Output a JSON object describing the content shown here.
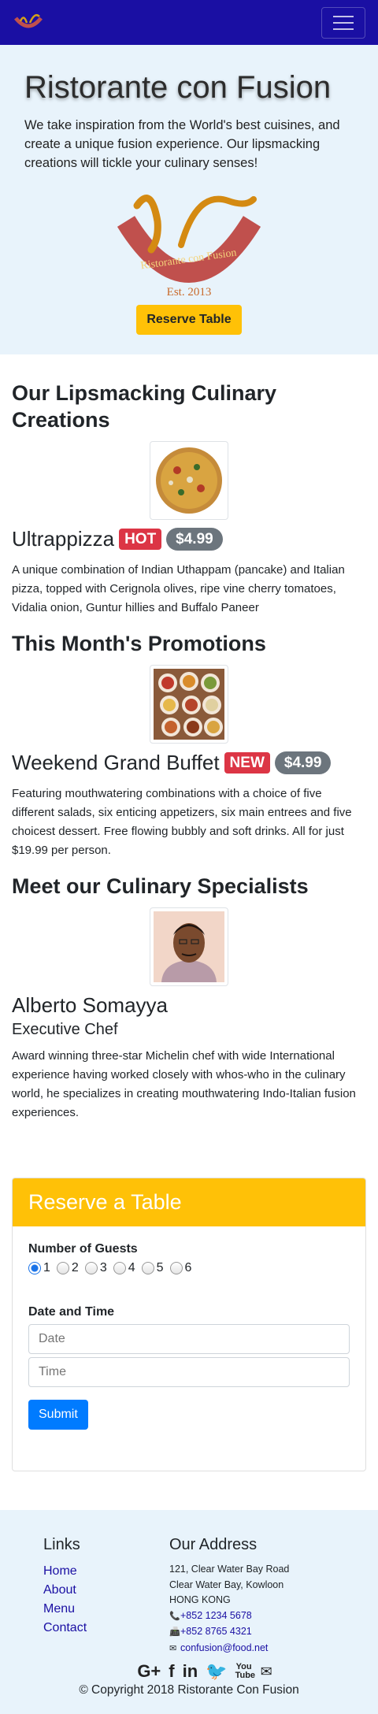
{
  "nav": {
    "logo_icon": "restaurant-logo-icon",
    "toggler_icon": "hamburger-menu-icon"
  },
  "jumbotron": {
    "title": "Ristorante con Fusion",
    "text": "We take inspiration from the World's best cuisines, and create a unique fusion experience. Our lipsmacking creations will tickle your culinary senses!",
    "logo_text": "Ristorante con Fusion",
    "est": "Est. 2013",
    "reserve_label": "Reserve Table"
  },
  "dish": {
    "section": "Our Lipsmacking Culinary Creations",
    "name": "Ultrappizza",
    "badge": "HOT",
    "price": "$4.99",
    "description": "A unique combination of Indian Uthappam (pancake) and Italian pizza, topped with Cerignola olives, ripe vine cherry tomatoes, Vidalia onion, Guntur hillies and Buffalo Paneer"
  },
  "promo": {
    "section": "This Month's Promotions",
    "name": "Weekend Grand Buffet",
    "badge": "NEW",
    "price": "$4.99",
    "description": "Featuring mouthwatering combinations with a choice of five different salads, six enticing appetizers, six main entrees and five choicest dessert. Free flowing bubbly and soft drinks. All for just $19.99 per person."
  },
  "leader": {
    "section": "Meet our Culinary Specialists",
    "name": "Alberto Somayya",
    "title": "Executive Chef",
    "description": "Award winning three-star Michelin chef with wide International experience having worked closely with whos-who in the culinary world, he specializes in creating mouthwatering Indo-Italian fusion experiences."
  },
  "reserve": {
    "header": "Reserve a Table",
    "guests_label": "Number of Guests",
    "guest_options": [
      "1",
      "2",
      "3",
      "4",
      "5",
      "6"
    ],
    "selected_guests": "1",
    "datetime_label": "Date and Time",
    "date_placeholder": "Date",
    "time_placeholder": "Time",
    "submit_label": "Submit"
  },
  "footer": {
    "links_title": "Links",
    "links": [
      "Home",
      "About",
      "Menu",
      "Contact"
    ],
    "address_title": "Our Address",
    "address_lines": [
      "121, Clear Water Bay Road",
      "Clear Water Bay, Kowloon",
      "HONG KONG"
    ],
    "phone": "+852 1234 5678",
    "fax": "+852 8765 4321",
    "email": "confusion@food.net",
    "social": [
      "G+",
      "f",
      "in",
      "🐦",
      "You Tube",
      "✉"
    ],
    "copyright": "© Copyright 2018 Ristorante Con Fusion"
  },
  "colors": {
    "navbar": "#1a0fa3",
    "jumbotron": "#e8f3fb",
    "accent": "#ffc107",
    "primary": "#007bff",
    "danger": "#dc3545",
    "secondary": "#6c757d"
  }
}
